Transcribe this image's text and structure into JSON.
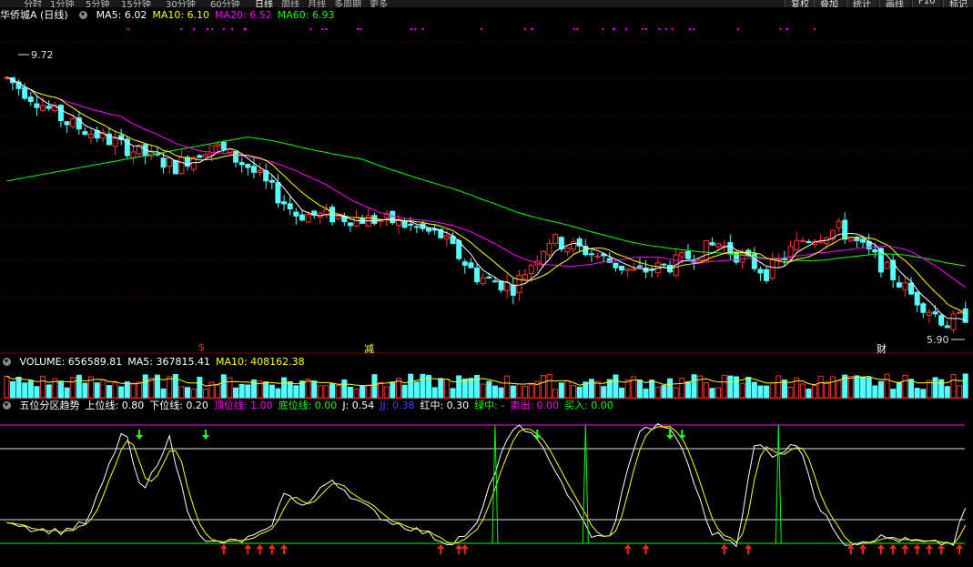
{
  "toolbar": {
    "tabs": [
      "分时",
      "1分钟",
      "5分钟",
      "15分钟",
      "30分钟",
      "60分钟",
      "日线",
      "周线",
      "月线",
      "多周期",
      "更多"
    ],
    "buttons": [
      "复权",
      "叠加",
      "统计",
      "画线",
      "F10",
      "标记"
    ]
  },
  "main_panel": {
    "title": "华侨城A (日线)",
    "indicators": [
      {
        "label": "MA5: 6.02",
        "color": "#ffffff"
      },
      {
        "label": "MA10: 6.10",
        "color": "#ffff00"
      },
      {
        "label": "MA20: 6.52",
        "color": "#ff00ff"
      },
      {
        "label": "MA60: 6.93",
        "color": "#00ff00"
      }
    ],
    "high_label": "9.72",
    "low_label": "5.90",
    "markers": [
      {
        "text": "$",
        "color": "#ff3030"
      },
      {
        "text": "减",
        "color": "#ffff00"
      },
      {
        "text": "财",
        "color": "#ffffff"
      }
    ]
  },
  "volume_panel": {
    "indicators": [
      {
        "label": "VOLUME: 656589.81",
        "color": "#ffffff"
      },
      {
        "label": "MA5: 367815.41",
        "color": "#ffffff"
      },
      {
        "label": "MA10: 408162.38",
        "color": "#ffff00"
      }
    ]
  },
  "indicator_panel": {
    "indicators": [
      {
        "label": "五位分区趋势",
        "color": "#ffffff"
      },
      {
        "label": "上位线: 0.80",
        "color": "#ffffff"
      },
      {
        "label": "下位线: 0.20",
        "color": "#ffffff"
      },
      {
        "label": "顶位线: 1.00",
        "color": "#ff00ff"
      },
      {
        "label": "底位线: 0.00",
        "color": "#00ff00"
      },
      {
        "label": "J: 0.54",
        "color": "#ffffff"
      },
      {
        "label": "JJ: 0.38",
        "color": "#4040ff"
      },
      {
        "label": "红中: 0.30",
        "color": "#ffffff"
      },
      {
        "label": "绿中: -",
        "color": "#00ff00"
      },
      {
        "label": "卖出: 0.00",
        "color": "#ff00ff"
      },
      {
        "label": "买入: 0.00",
        "color": "#00ff00"
      }
    ]
  },
  "chart_data": {
    "type": "bar",
    "series": [
      {
        "name": "MA5",
        "values": [
          6.02
        ]
      },
      {
        "name": "MA10",
        "values": [
          6.1
        ]
      },
      {
        "name": "MA20",
        "values": [
          6.52
        ]
      },
      {
        "name": "MA60",
        "values": [
          6.93
        ]
      }
    ],
    "ylim": [
      5.9,
      9.72
    ],
    "colors": {
      "up": "#ff3030",
      "down": "#54ffff",
      "ma5": "#ffffff",
      "ma10": "#ffff00",
      "ma20": "#ff00ff",
      "ma60": "#00ff00"
    }
  }
}
